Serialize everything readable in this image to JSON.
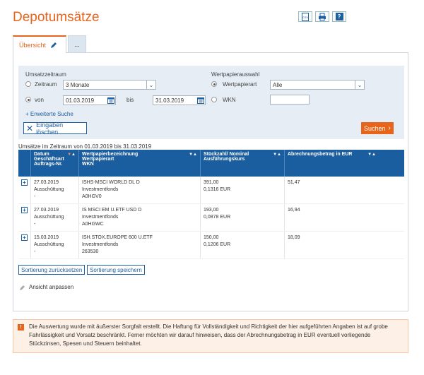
{
  "page": {
    "title": "Depotumsätze"
  },
  "tools": {
    "csv": "CSV",
    "print": "print-icon",
    "help": "?"
  },
  "tabs": [
    {
      "label": "Übersicht"
    },
    {
      "label": "..."
    }
  ],
  "filter": {
    "period_heading": "Umsatzzeitraum",
    "zeitraum_label": "Zeitraum",
    "zeitraum_value": "3 Monate",
    "von_label": "von",
    "von_value": "01.03.2019",
    "bis_label": "bis",
    "bis_value": "31.03.2019",
    "paper_heading": "Wertpapierauswahl",
    "wpart_label": "Wertpapierart",
    "wpart_value": "Alle",
    "wkn_label": "WKN",
    "wkn_value": "",
    "extended_search": "Erweiterte Suche",
    "clear_label": "Eingaben löschen",
    "search_label": "Suchen"
  },
  "summary": "Umsätze im Zeitraum von 01.03.2019 bis 31.03.2019",
  "table": {
    "headers": [
      [
        "Datum",
        "Geschäftsart",
        "Auftrags-Nr."
      ],
      [
        "Wertpapierbezeichnung",
        "Wertpapierart",
        "WKN"
      ],
      [
        "Stückzahl/ Nominal",
        "Ausführungskurs"
      ],
      [
        "Abrechnungsbetrag in EUR"
      ]
    ],
    "rows": [
      {
        "date": "27.03.2019",
        "type": "Ausschüttung",
        "order": "-",
        "name": "ISHS-MSCI WORLD DL D",
        "kind": "Investmentfonds",
        "wkn": "A0HGV0",
        "qty": "391,00",
        "rate": "0,1316 EUR",
        "amount": "51,47"
      },
      {
        "date": "27.03.2019",
        "type": "Ausschüttung",
        "order": "-",
        "name": "IS MSCI EM U.ETF USD D",
        "kind": "Investmentfonds",
        "wkn": "A0HGWC",
        "qty": "193,00",
        "rate": "0,0878 EUR",
        "amount": "16,94"
      },
      {
        "date": "15.03.2019",
        "type": "Ausschüttung",
        "order": "-",
        "name": "ISH.STOX.EUROPE 600 U.ETF",
        "kind": "Investmentfonds",
        "wkn": "263530",
        "qty": "150,00",
        "rate": "0,1206 EUR",
        "amount": "18,09"
      }
    ]
  },
  "actions": {
    "reset_sort": "Sortierung zurücksetzen",
    "save_sort": "Sortierung speichern",
    "customize": "Ansicht anpassen"
  },
  "notice": "Die Auswertung wurde mit äußerster Sorgfalt erstellt. Die Haftung für Vollständigkeit und Richtigkeit der hier aufgeführten Angaben ist auf grobe Fahrlässigkeit und Vorsatz beschränkt. Ferner möchten wir darauf hinweisen, dass der Abrechnungsbetrag in EUR eventuell vorliegende Stückzinsen, Spesen und Steuern beinhaltet.",
  "colors": {
    "accent": "#e8641b",
    "primary": "#1b5e9f",
    "filter_bg": "#e6edf5"
  }
}
